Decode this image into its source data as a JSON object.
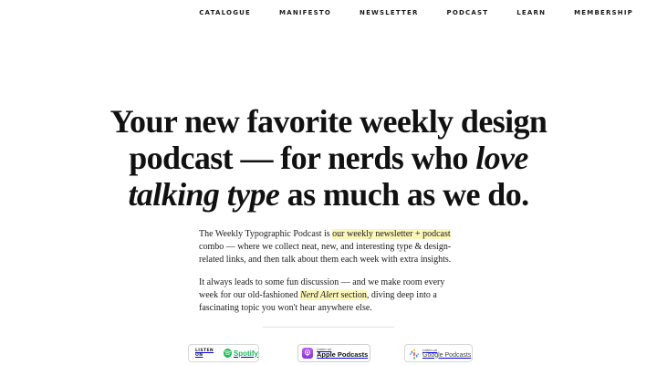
{
  "nav": {
    "items": [
      {
        "label": "CATALOGUE"
      },
      {
        "label": "MANIFESTO"
      },
      {
        "label": "NEWSLETTER"
      },
      {
        "label": "PODCAST"
      },
      {
        "label": "LEARN"
      },
      {
        "label": "MEMBERSHIP"
      }
    ]
  },
  "hero": {
    "line1": "Your new favorite weekly design",
    "line2_prefix": "podcast — for nerds who ",
    "line2_em": "love",
    "line3_em": "talking type",
    "line3_suffix": " as much as we do."
  },
  "intro": {
    "p1_prefix": "The Weekly Typographic Podcast is ",
    "p1_link": "our weekly newsletter + podcast",
    "p1_suffix": " combo — where we collect neat, new, and interesting type & design-related links, and then talk about them each week with extra insights.",
    "p2_prefix": "It always leads to some fun discussion — and we make room every week for our old-fashioned ",
    "p2_link_em": "Nerd Alert",
    "p2_link_rest": " section",
    "p2_suffix": ", diving deep into a fascinating topic you won't hear anywhere else."
  },
  "badges": {
    "spotify": {
      "small": "LISTEN ON",
      "name": "Spotify"
    },
    "apple": {
      "small": "Listen on",
      "name": "Apple Podcasts"
    },
    "google": {
      "small": "Listen on",
      "name": "Google Podcasts"
    }
  },
  "colors": {
    "highlight": "#fbf6b9",
    "spotify_green": "#1db954",
    "apple_purple": "#a44ae8"
  }
}
